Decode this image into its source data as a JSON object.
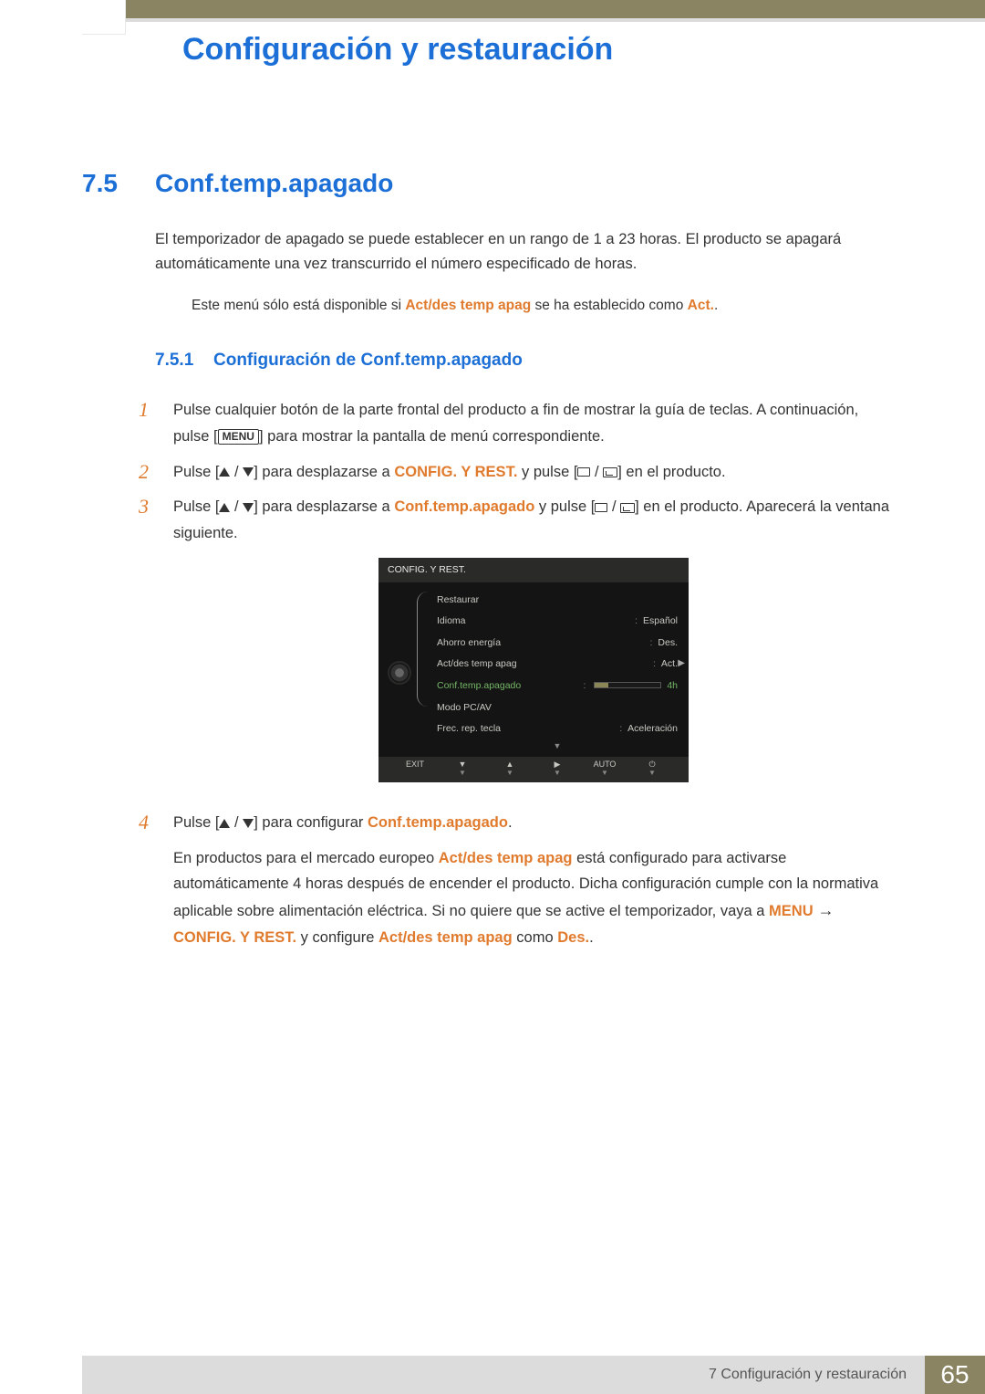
{
  "chapter_title": "Configuración y restauración",
  "section": {
    "num": "7.5",
    "title": "Conf.temp.apagado"
  },
  "intro": "El temporizador de apagado se puede establecer en un rango de 1 a 23 horas. El producto se apagará automáticamente una vez transcurrido el número especificado de horas.",
  "note_prefix": "Este menú sólo está disponible si ",
  "note_hl1": "Act/des temp apag",
  "note_mid": " se ha establecido como ",
  "note_hl2": "Act.",
  "note_suffix": ".",
  "subsection": {
    "num": "7.5.1",
    "title": "Configuración de Conf.temp.apagado"
  },
  "steps": {
    "s1a": "Pulse cualquier botón de la parte frontal del producto a fin de mostrar la guía de teclas. A continuación, pulse [",
    "s1_menu": "MENU",
    "s1b": "] para mostrar la pantalla de menú correspondiente.",
    "s2a": "Pulse [",
    "s2b": "] para desplazarse a ",
    "s2_hl": "CONFIG. Y REST.",
    "s2c": " y pulse [",
    "s2d": "] en el producto.",
    "s3a": "Pulse [",
    "s3b": "] para desplazarse a ",
    "s3_hl": "Conf.temp.apagado",
    "s3c": " y pulse [",
    "s3d": "] en el producto. Aparecerá la ventana siguiente.",
    "s4a": "Pulse [",
    "s4b": "] para configurar ",
    "s4_hl": "Conf.temp.apagado",
    "s4c": "."
  },
  "osd": {
    "header": "CONFIG. Y REST.",
    "rows": [
      {
        "label": "Restaurar",
        "value": ""
      },
      {
        "label": "Idioma",
        "value": "Español"
      },
      {
        "label": "Ahorro energía",
        "value": "Des."
      },
      {
        "label": "Act/des temp apag",
        "value": "Act."
      },
      {
        "label": "Conf.temp.apagado",
        "value": "4h",
        "active": true,
        "bar": 0.2
      },
      {
        "label": "Modo PC/AV",
        "value": ""
      },
      {
        "label": "Frec. rep. tecla",
        "value": "Aceleración"
      }
    ],
    "footer": [
      {
        "top": "EXIT",
        "bot": ""
      },
      {
        "top": "▼",
        "bot": "▼"
      },
      {
        "top": "▲",
        "bot": "▼"
      },
      {
        "top": "▶",
        "bot": "▼"
      },
      {
        "top": "AUTO",
        "bot": "▼"
      },
      {
        "top": "⏻",
        "bot": "▼"
      }
    ]
  },
  "subnote": {
    "a": "En productos para el mercado europeo ",
    "hl1": "Act/des temp apag",
    "b": " está configurado para activarse automáticamente 4 horas después de encender el producto. Dicha configuración cumple con la normativa aplicable sobre alimentación eléctrica. Si no quiere que se active el temporizador, vaya a ",
    "hl2": "MENU",
    "c": "  →  ",
    "hl3": "CONFIG. Y REST.",
    "d": " y configure ",
    "hl4": "Act/des temp apag",
    "e": " como ",
    "hl5": "Des.",
    "f": "."
  },
  "footer": {
    "label": "7 Configuración y restauración",
    "page": "65"
  }
}
